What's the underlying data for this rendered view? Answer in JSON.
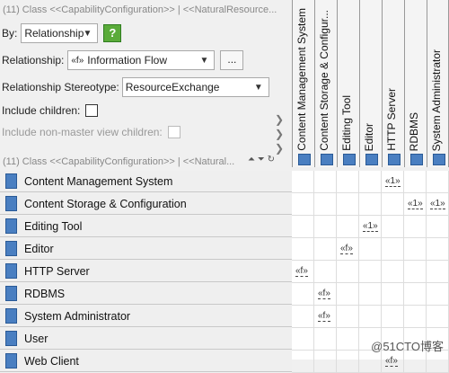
{
  "top_title": "(11) Class <<CapabilityConfiguration>> | <<NaturalResource...",
  "by": {
    "label": "By:",
    "value": "Relationship",
    "help_label": "?"
  },
  "relationship": {
    "label": "Relationship:",
    "value": "Information Flow",
    "flow_symbol": "«f»",
    "more_label": "..."
  },
  "stereotype": {
    "label": "Relationship Stereotype:",
    "value": "ResourceExchange"
  },
  "include_children": {
    "label": "Include children:"
  },
  "include_nonmaster": {
    "label": "Include non-master view children:"
  },
  "tree_title": "(11) Class <<CapabilityConfiguration>> | <<Natural...",
  "columns": [
    "Content Management System",
    "Content Storage & Configur...",
    "Editing Tool",
    "Editor",
    "HTTP Server",
    "RDBMS",
    "System Administrator"
  ],
  "rows": [
    "Content Management System",
    "Content Storage & Configuration",
    "Editing Tool",
    "Editor",
    "HTTP Server",
    "RDBMS",
    "System Administrator",
    "User",
    "Web Client"
  ],
  "flows": [
    {
      "row": 0,
      "col": 4,
      "label": "«1»"
    },
    {
      "row": 1,
      "col": 5,
      "label": "«1»"
    },
    {
      "row": 1,
      "col": 6,
      "label": "«1»"
    },
    {
      "row": 2,
      "col": 3,
      "label": "«1»"
    },
    {
      "row": 3,
      "col": 2,
      "label": "«f»"
    },
    {
      "row": 4,
      "col": 0,
      "label": "«f»"
    },
    {
      "row": 5,
      "col": 1,
      "label": "«f»"
    },
    {
      "row": 6,
      "col": 1,
      "label": "«f»"
    },
    {
      "row": 8,
      "col": 4,
      "label": "«f»"
    }
  ],
  "watermark": "@51CTO博客",
  "colors": {
    "icon_blue": "#4a7fc1",
    "help_green": "#5aab3a"
  }
}
